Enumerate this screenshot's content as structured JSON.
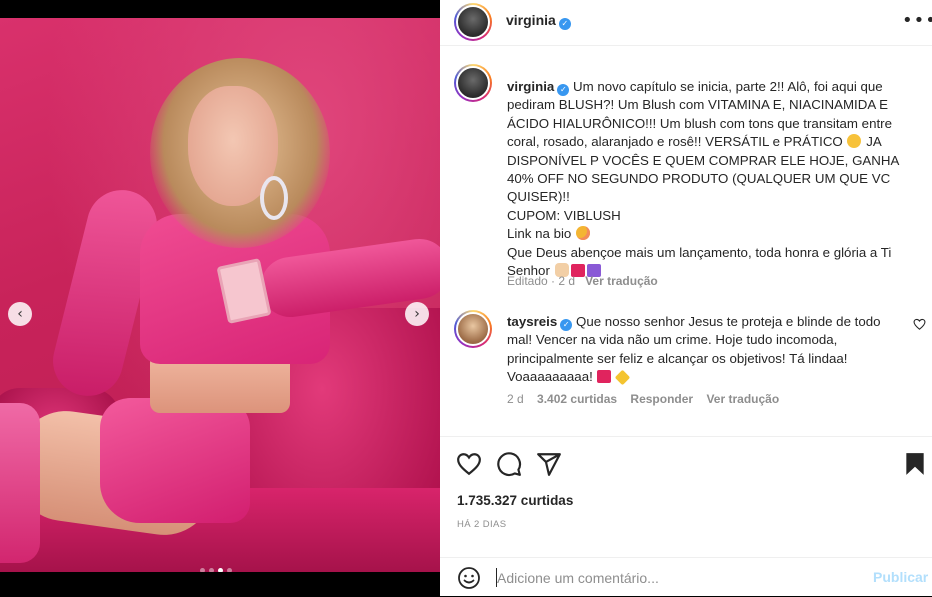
{
  "post": {
    "username": "virginia",
    "more_icon": "•••",
    "caption_line1": "Um novo capítulo se inicia, parte 2!! Alô, foi aqui que pediram BLUSH?! Um Blush com VITAMINA E, NIACINAMIDA E ÁCIDO HIALURÔNICO!!! Um blush com tons que transitam entre coral, rosado, alaranjado e rosê!! VERSÁTIL e PRÁTICO",
    "caption_line2": "JA DISPONÍVEL P VOCÊS E QUEM COMPRAR ELE HOJE, GANHA 40% OFF NO SEGUNDO PRODUTO (QUALQUER UM QUE VC QUISER)!!",
    "coupon": "CUPOM: VIBLUSH",
    "link_bio": "Link na bio",
    "blessing": "Que Deus abençoe mais um lançamento, toda honra e glória a Ti Senhor",
    "caption_meta": {
      "edited": "Editado · 2 d",
      "see_translation": "Ver tradução"
    },
    "carousel": {
      "total": 4,
      "active_index": 2
    }
  },
  "comment": {
    "username": "taysreis",
    "text": "Que nosso senhor Jesus te proteja e blinde de todo mal! Vencer na vida não um crime. Hoje tudo incomoda, principalmente ser feliz e alcançar os objetivos! Tá lindaa! Voaaaaaaaaa!",
    "time": "2 d",
    "likes": "3.402 curtidas",
    "reply": "Responder",
    "see_translation": "Ver tradução"
  },
  "footer": {
    "likes": "1.735.327 curtidas",
    "posted": "HÁ 2 DIAS",
    "comment_placeholder": "Adicione um comentário...",
    "publish": "Publicar"
  },
  "colors": {
    "accent_blue": "#3897f0",
    "publish_disabled": "#b2dffc",
    "muted": "#8e8e8e"
  },
  "icons": [
    "like-icon",
    "comment-icon",
    "share-icon",
    "save-icon",
    "emoji-icon",
    "more-icon",
    "chevron-left-icon",
    "chevron-right-icon",
    "verified-icon"
  ]
}
